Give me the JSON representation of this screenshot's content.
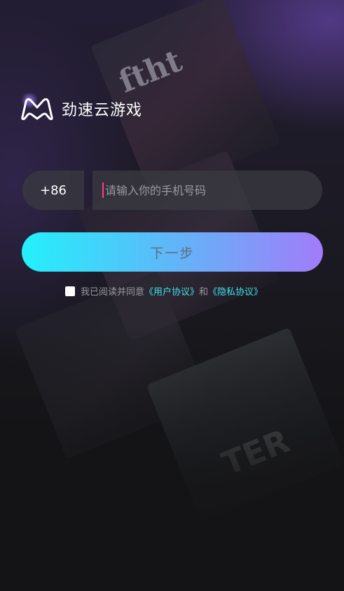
{
  "brand": {
    "name": "劲速云游戏",
    "logo_icon": "game-controller-m-logo"
  },
  "login": {
    "country_code": "+86",
    "phone_placeholder": "请输入你的手机号码",
    "phone_value": "",
    "next_label": "下一步"
  },
  "agreement": {
    "prefix": "我已阅读并同意",
    "user_agreement": "《用户协议》",
    "conjunction": "和",
    "privacy_agreement": "《隐私协议》",
    "checked": false
  },
  "colors": {
    "accent_start": "#23f0fb",
    "accent_end": "#a17cf9",
    "link": "#41e1ea",
    "caret": "#ff3e8a"
  }
}
